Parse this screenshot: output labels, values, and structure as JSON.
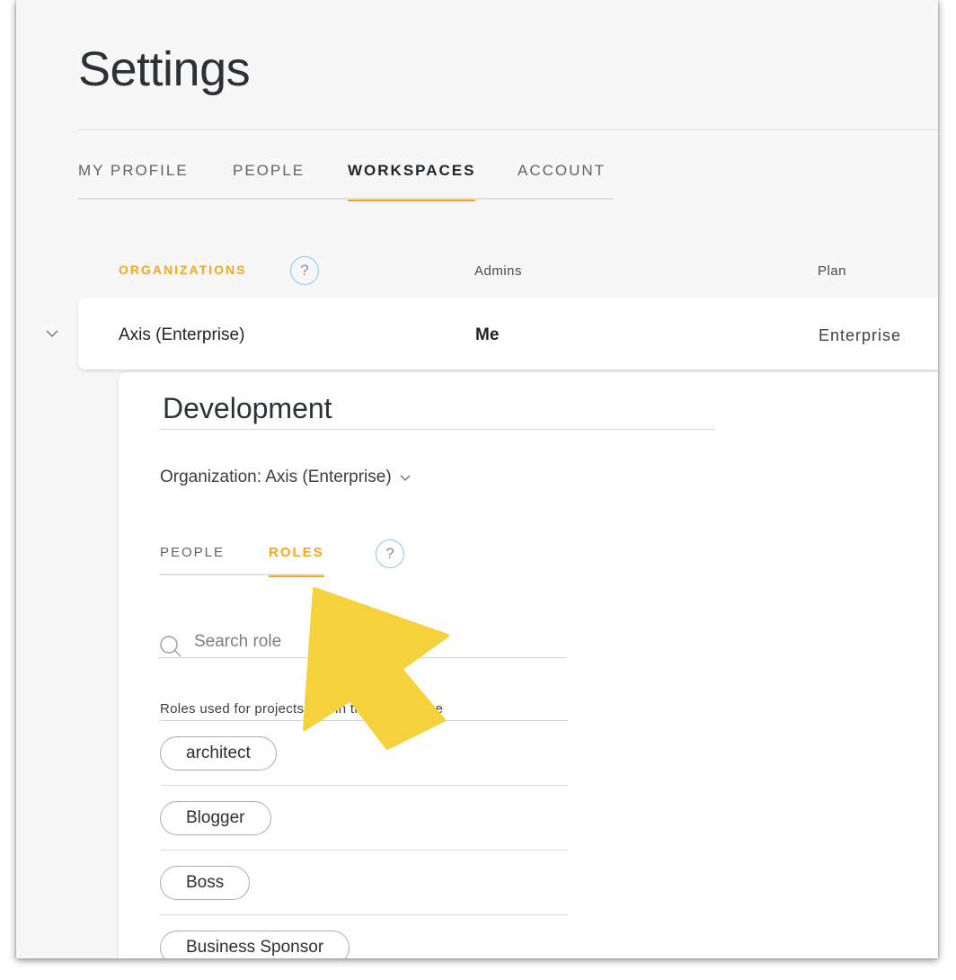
{
  "page": {
    "title": "Settings"
  },
  "main_tabs": [
    {
      "label": "MY PROFILE",
      "active": false
    },
    {
      "label": "PEOPLE",
      "active": false
    },
    {
      "label": "WORKSPACES",
      "active": true
    },
    {
      "label": "ACCOUNT",
      "active": false
    }
  ],
  "org_table": {
    "header_label": "ORGANIZATIONS",
    "help": "?",
    "col_admins": "Admins",
    "col_plan": "Plan",
    "row": {
      "name": "Axis (Enterprise)",
      "admins": "Me",
      "plan": "Enterprise"
    }
  },
  "workspace": {
    "name": "Development",
    "organization_label": "Organization: Axis (Enterprise)",
    "sub_tabs": [
      {
        "label": "PEOPLE",
        "active": false
      },
      {
        "label": "ROLES",
        "active": true
      }
    ],
    "help": "?",
    "search": {
      "placeholder": "Search role",
      "value": ""
    },
    "roles_caption": "Roles used for projects and in this workspace",
    "roles": [
      "architect",
      "Blogger",
      "Boss",
      "Business Sponsor"
    ]
  },
  "colors": {
    "accent": "#f5a623",
    "help_ring": "#8cc4ec",
    "annotation_arrow": "#f5d13c"
  },
  "annotation": {
    "icon": "pointer-arrow-icon"
  }
}
